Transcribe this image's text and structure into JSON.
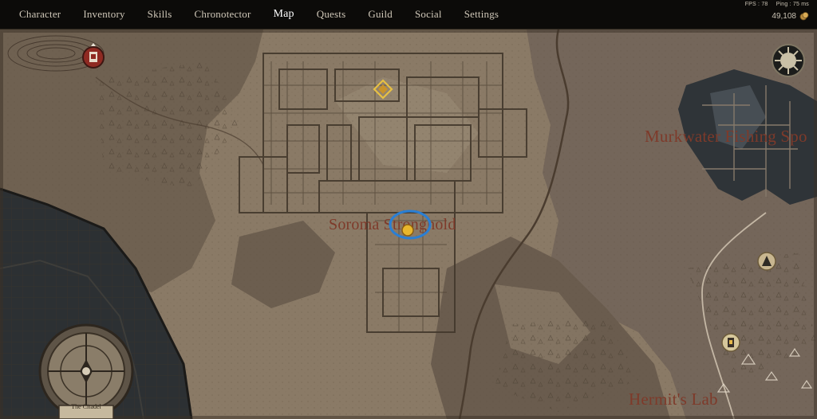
{
  "nav": {
    "items": [
      {
        "label": "Character",
        "active": false
      },
      {
        "label": "Inventory",
        "active": false
      },
      {
        "label": "Skills",
        "active": false
      },
      {
        "label": "Chronotector",
        "active": false
      },
      {
        "label": "Map",
        "active": true
      },
      {
        "label": "Quests",
        "active": false
      },
      {
        "label": "Guild",
        "active": false
      },
      {
        "label": "Social",
        "active": false
      },
      {
        "label": "Settings",
        "active": false
      }
    ]
  },
  "stats": {
    "fps": "FPS : 78",
    "ping": "Ping : 75 ms",
    "currency": "49,108",
    "currency_icon": "coin-icon"
  },
  "map": {
    "locations": [
      {
        "name": "Soroma Stronghold"
      },
      {
        "name": "Murkwater Fishing Spo"
      },
      {
        "name": "Hermit's Lab"
      }
    ],
    "compass_label": "The Citadel",
    "icons": [
      "tower-icon",
      "waypoint-icon",
      "player-marker-icon",
      "compass-emblem-icon",
      "shrine-icon",
      "lantern-icon"
    ],
    "colors": {
      "parchment": "#8a7a66",
      "ink": "#4a3d30",
      "label": "#7e3a2a",
      "water": "#2c3033",
      "marker_ring": "#2a7fd4",
      "player_marker": "#e8b62c"
    }
  }
}
